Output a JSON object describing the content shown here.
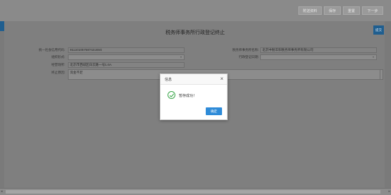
{
  "toolbar": {
    "btn1": "附送资料",
    "btn2": "保存",
    "btn3": "重置",
    "btn4": "下一步"
  },
  "side_button": "提交",
  "page_title": "税务师事务所行政登记终止",
  "form": {
    "credit_code_label": "统一社会信用代码:",
    "credit_code_value": "91110105758742165G",
    "firm_name_label": "税务师事务所名称:",
    "firm_name_value": "北京中税华阳税务师事务所有限公司",
    "org_form_label": "组织形式:",
    "org_form_value": "",
    "reg_date_label": "行政登记日期:",
    "reg_date_value": "",
    "address_label": "经营场所:",
    "address_value": "北京市西城区白云路一号1.6A",
    "reason_label": "终止原因:",
    "reason_value": "资金不足"
  },
  "dialog": {
    "title": "信息",
    "close": "×",
    "message": "暂存成功！",
    "ok_label": "确定"
  },
  "scroll": {
    "left": "◂",
    "right": "▸"
  }
}
